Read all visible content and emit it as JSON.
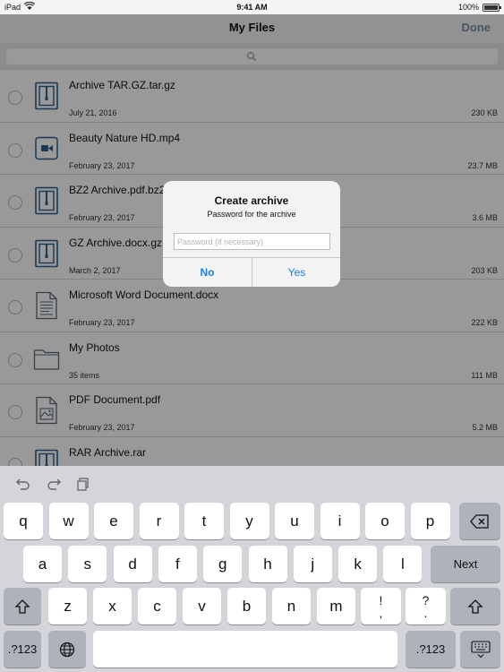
{
  "status_bar": {
    "device": "iPad",
    "time": "9:41 AM",
    "battery_percent": "100%",
    "battery_level": 1.0
  },
  "nav": {
    "title": "My Files",
    "done_label": "Done"
  },
  "search": {
    "icon": "search-icon"
  },
  "files": [
    {
      "name": "Archive TAR.GZ.tar.gz",
      "date": "July 21, 2016",
      "size": "230 KB",
      "icon": "archive-icon"
    },
    {
      "name": "Beauty Nature HD.mp4",
      "date": "February 23, 2017",
      "size": "23.7 MB",
      "icon": "video-icon"
    },
    {
      "name": "BZ2 Archive.pdf.bz2",
      "date": "February 23, 2017",
      "size": "3.6 MB",
      "icon": "archive-icon"
    },
    {
      "name": "GZ Archive.docx.gz",
      "date": "March 2, 2017",
      "size": "203 KB",
      "icon": "archive-icon"
    },
    {
      "name": "Microsoft Word Document.docx",
      "date": "February 23, 2017",
      "size": "222 KB",
      "icon": "document-icon"
    },
    {
      "name": "My Photos",
      "date": "35 items",
      "size": "111 MB",
      "icon": "folder-icon"
    },
    {
      "name": "PDF Document.pdf",
      "date": "February 23, 2017",
      "size": "5.2 MB",
      "icon": "image-document-icon"
    },
    {
      "name": "RAR Archive.rar",
      "date": "",
      "size": "",
      "icon": "archive-icon"
    }
  ],
  "dialog": {
    "title": "Create archive",
    "message": "Password for the archive",
    "placeholder": "Password (if necessary)",
    "no_label": "No",
    "yes_label": "Yes"
  },
  "keyboard": {
    "row1": [
      "q",
      "w",
      "e",
      "r",
      "t",
      "y",
      "u",
      "i",
      "o",
      "p"
    ],
    "row2": [
      "a",
      "s",
      "d",
      "f",
      "g",
      "h",
      "j",
      "k",
      "l"
    ],
    "row3": [
      "z",
      "x",
      "c",
      "v",
      "b",
      "n",
      "m"
    ],
    "next_label": "Next",
    "numbers_label": ".?123",
    "punct1": [
      "!",
      ","
    ],
    "punct2": [
      "?",
      "."
    ]
  }
}
